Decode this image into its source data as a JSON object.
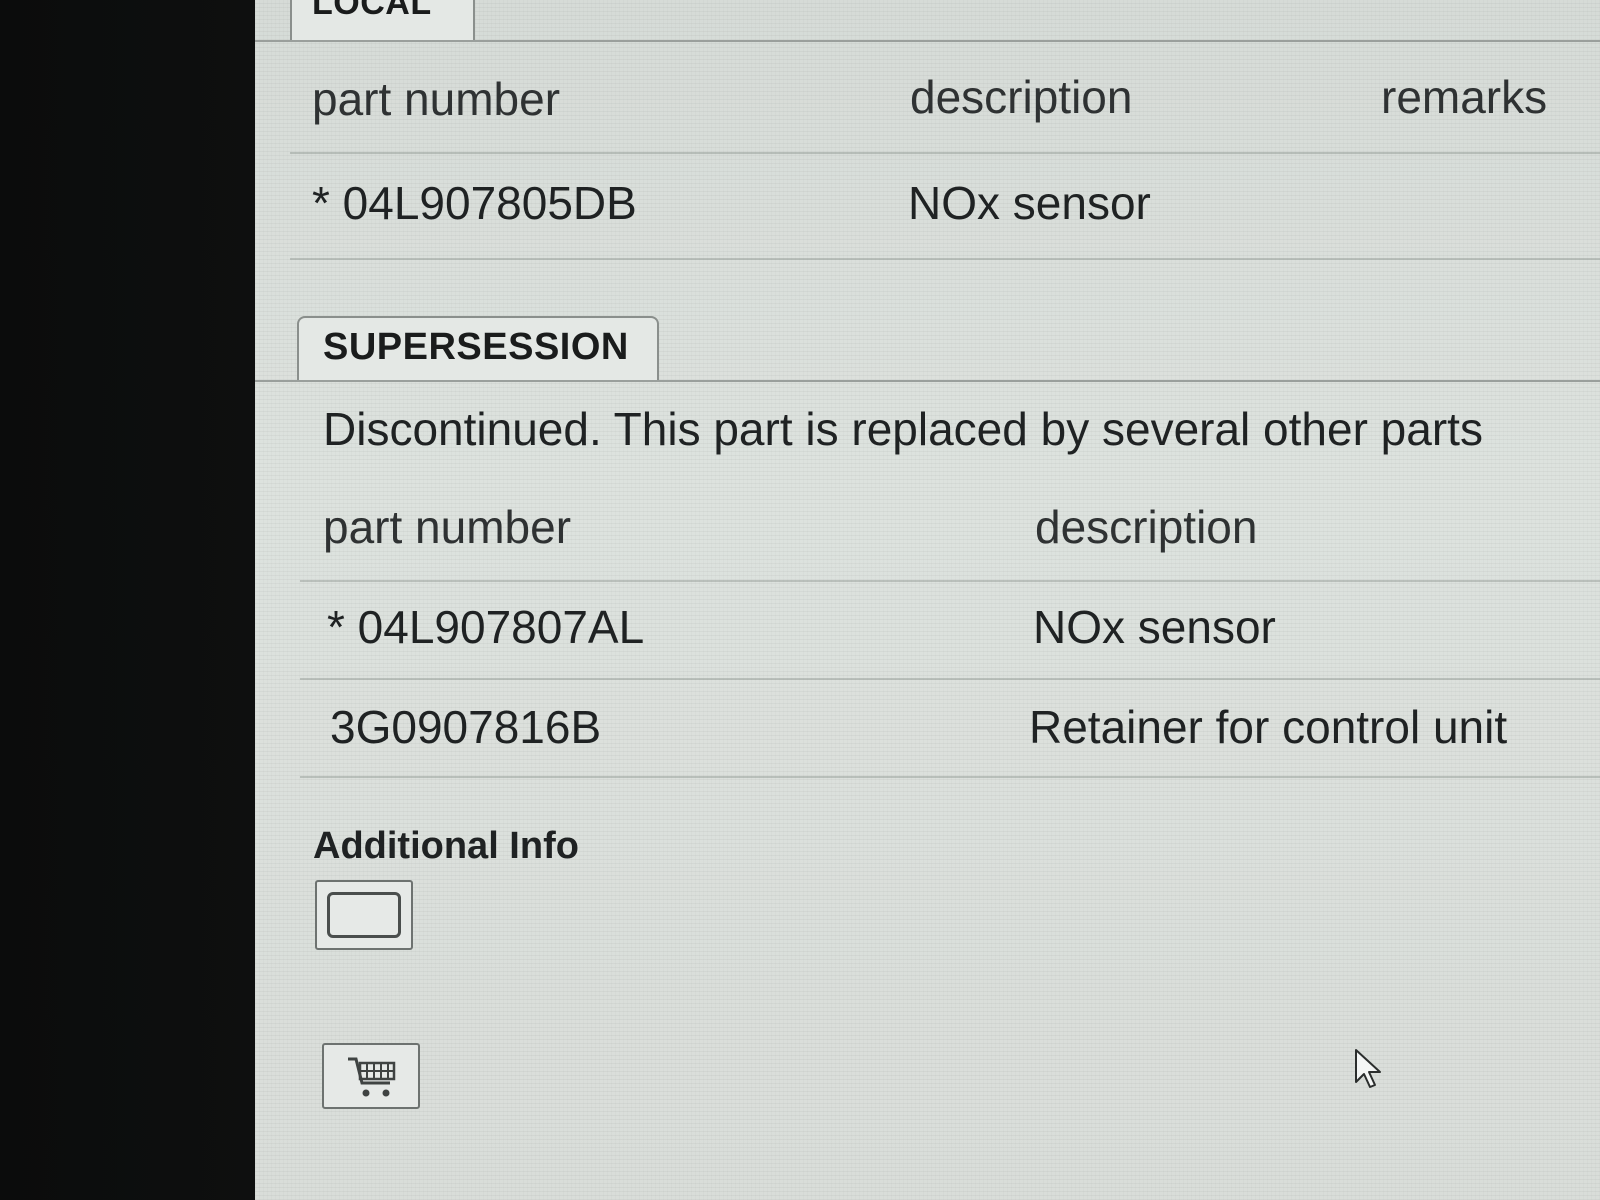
{
  "local": {
    "tab_label": "LOCAL",
    "columns": [
      "part number",
      "description",
      "remarks"
    ],
    "rows": [
      {
        "part_number": "* 04L907805DB",
        "description": "NOx sensor",
        "remarks": ""
      }
    ]
  },
  "supersession": {
    "tab_label": "SUPERSESSION",
    "notice": "Discontinued. This part is replaced by several other parts",
    "columns": [
      "part number",
      "description"
    ],
    "rows": [
      {
        "part_number": "* 04L907807AL",
        "description": "NOx sensor"
      },
      {
        "part_number": "3G0907816B",
        "description": "Retainer for control unit"
      }
    ]
  },
  "additional_info": {
    "label": "Additional Info",
    "info_icon": "info-window-icon",
    "cart_icon": "shopping-cart-icon"
  },
  "colors": {
    "screen_bg": "#d9ddd9",
    "text": "#1f2223",
    "bezel": "#0e0f0f"
  }
}
